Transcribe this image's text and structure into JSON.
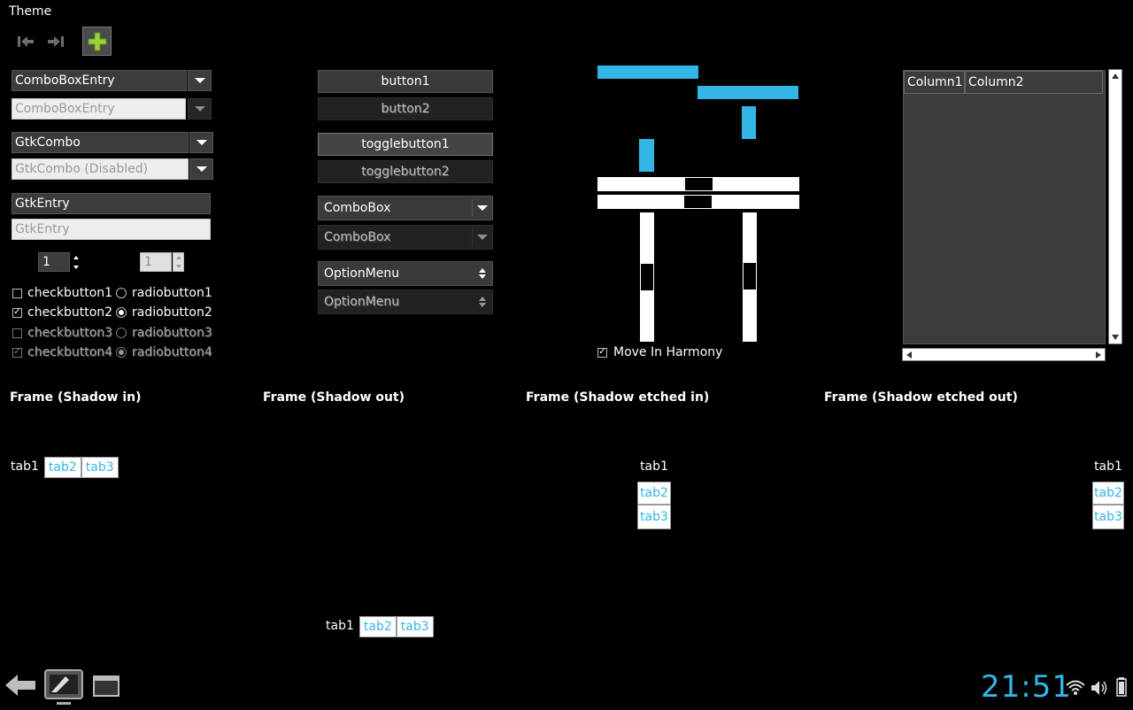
{
  "window": {
    "title": "Theme"
  },
  "toolbar": {
    "buttons": [
      {
        "icon": "go-first-icon"
      },
      {
        "icon": "go-last-icon"
      },
      {
        "icon": "add-icon"
      }
    ]
  },
  "left": {
    "combo_entry_1": "ComboBoxEntry",
    "combo_entry_2": "ComboBoxEntry",
    "gtk_combo_1": "GtkCombo",
    "gtk_combo_2": "GtkCombo (Disabled)",
    "entry_1": "GtkEntry",
    "entry_2": "GtkEntry",
    "spin_1": "1",
    "spin_2": "1",
    "checks": [
      {
        "label": "checkbutton1",
        "checked": false,
        "disabled": false
      },
      {
        "label": "checkbutton2",
        "checked": true,
        "disabled": false
      },
      {
        "label": "checkbutton3",
        "checked": false,
        "disabled": true
      },
      {
        "label": "checkbutton4",
        "checked": true,
        "disabled": true
      }
    ],
    "radios": [
      {
        "label": "radiobutton1",
        "selected": false,
        "disabled": false
      },
      {
        "label": "radiobutton2",
        "selected": true,
        "disabled": false
      },
      {
        "label": "radiobutton3",
        "selected": false,
        "disabled": true
      },
      {
        "label": "radiobutton4",
        "selected": true,
        "disabled": true
      }
    ]
  },
  "middle": {
    "button1": "button1",
    "button2": "button2",
    "toggle1": "togglebutton1",
    "toggle2": "togglebutton2",
    "combobox1": "ComboBox",
    "combobox2": "ComboBox",
    "option1": "OptionMenu",
    "option2": "OptionMenu"
  },
  "sliders": {
    "harmony_label": "Move In Harmony",
    "harmony_checked": true
  },
  "tree": {
    "columns": [
      "Column1",
      "Column2"
    ]
  },
  "frames": {
    "shadow_in": "Frame (Shadow in)",
    "shadow_out": "Frame (Shadow out)",
    "etched_in": "Frame (Shadow etched in)",
    "etched_out": "Frame (Shadow etched out)"
  },
  "tabs": {
    "labels": [
      "tab1",
      "tab2",
      "tab3"
    ]
  },
  "systembar": {
    "clock": "21:51",
    "colors": {
      "accent": "#33b5e5"
    }
  }
}
